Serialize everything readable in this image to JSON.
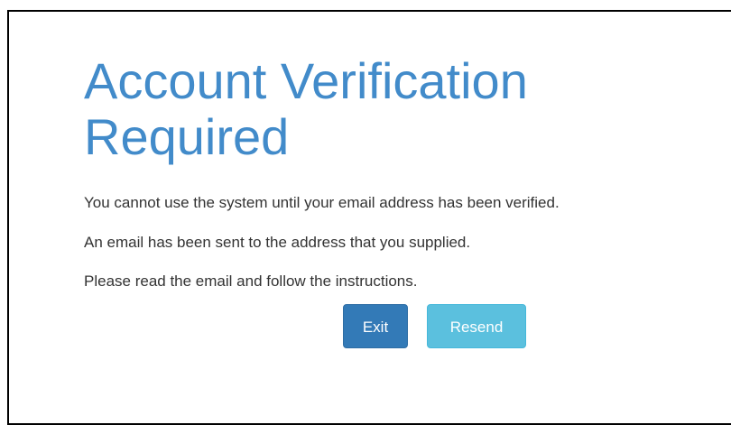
{
  "page": {
    "title_line1": "Account Verification",
    "title_line2": "Required",
    "messages": [
      "You cannot use the system until your email address has been verified.",
      "An email has been sent to the address that you supplied.",
      "Please read the email and follow the instructions."
    ]
  },
  "buttons": {
    "exit_label": "Exit",
    "resend_label": "Resend"
  },
  "colors": {
    "title": "#428bca",
    "text": "#333333",
    "exit_button": "#337ab7",
    "resend_button": "#5bc0de"
  }
}
